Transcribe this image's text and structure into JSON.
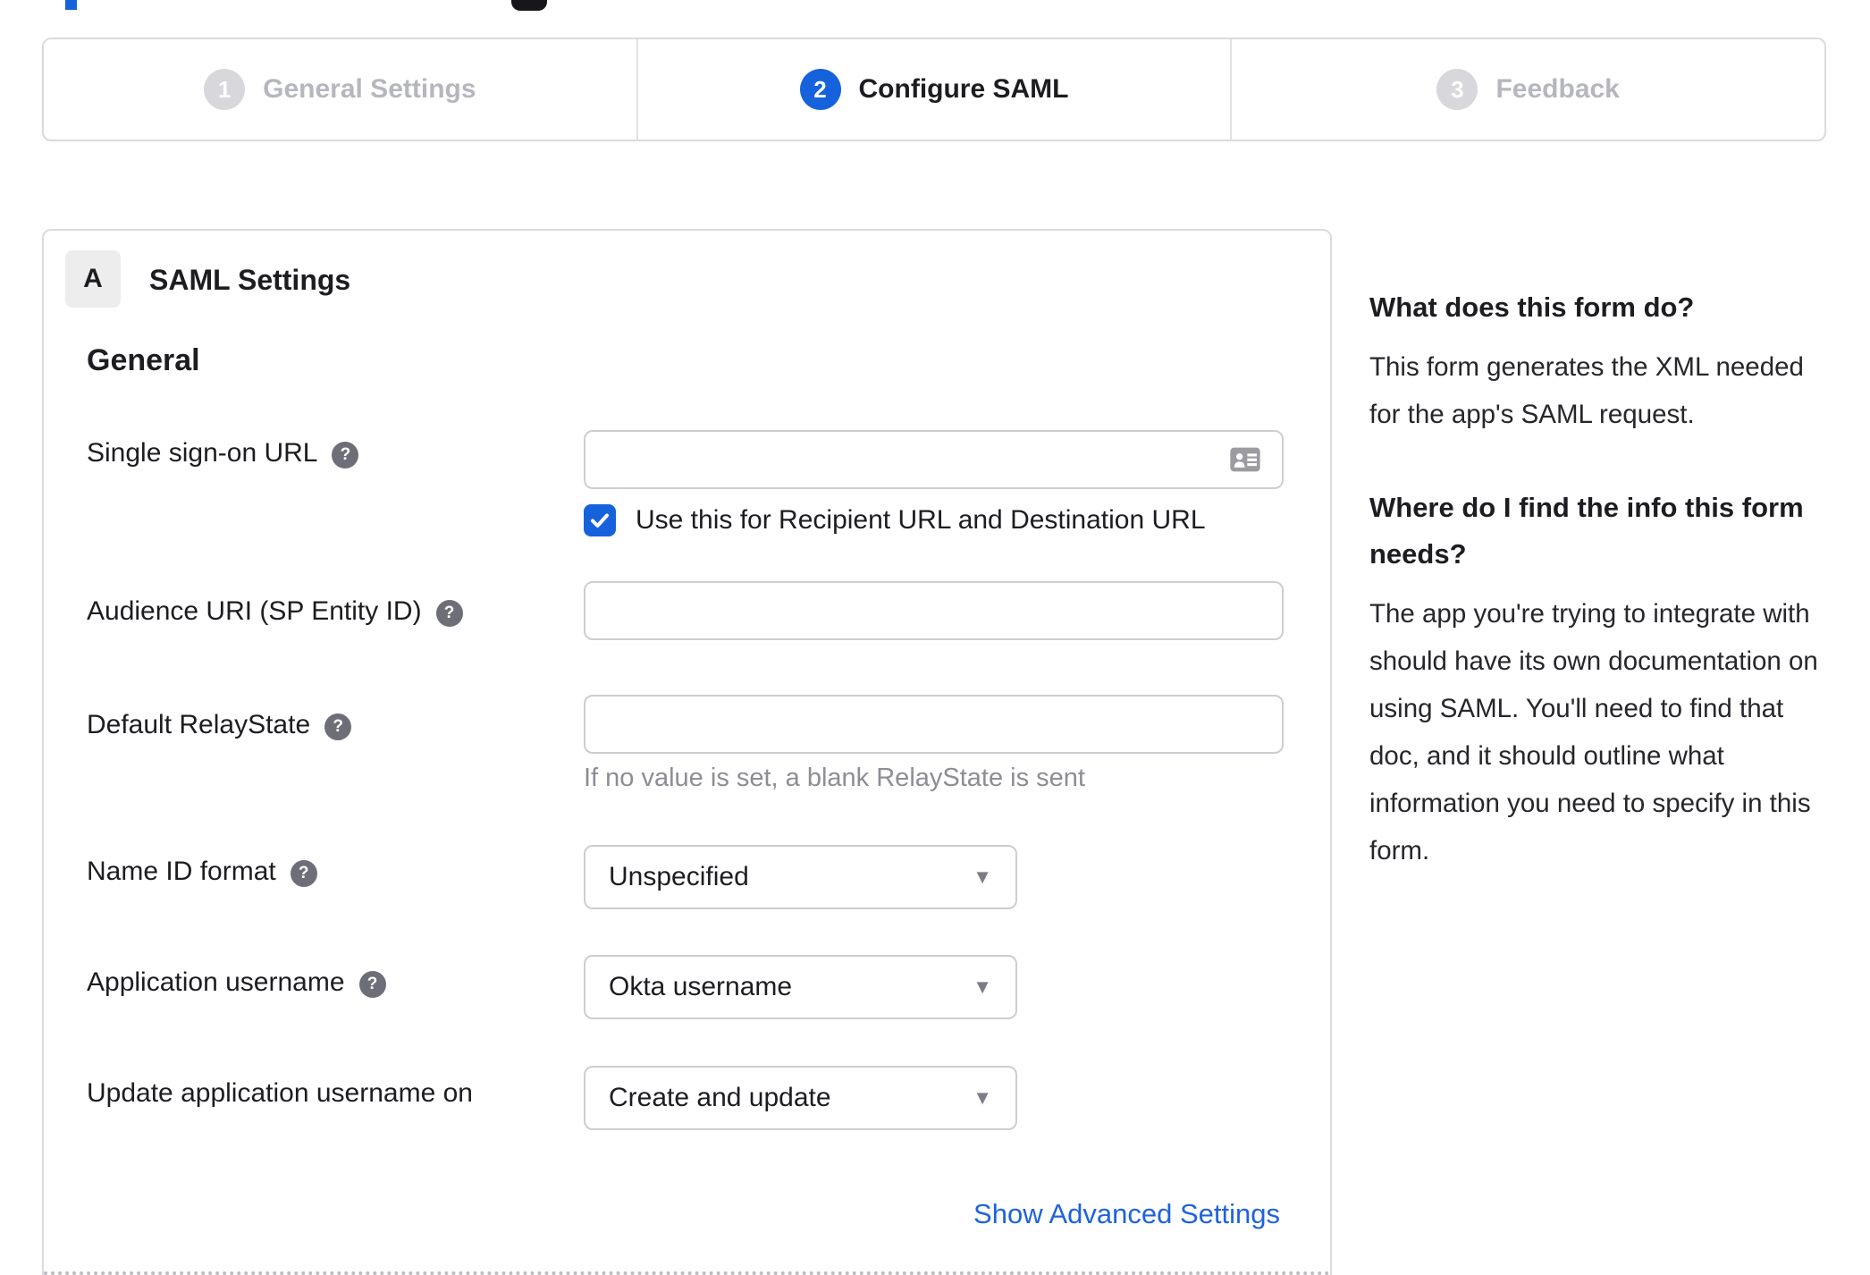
{
  "icons": {
    "help_glyph": "?",
    "caret_glyph": "▼"
  },
  "colors": {
    "accent_blue": "#1662dd",
    "inactive_gray": "#d7d7dc",
    "border_gray": "#dbdbdf",
    "muted_text": "#8d8d95"
  },
  "stepper": {
    "steps": [
      {
        "number": "1",
        "label": "General Settings",
        "state": "inactive"
      },
      {
        "number": "2",
        "label": "Configure SAML",
        "state": "active"
      },
      {
        "number": "3",
        "label": "Feedback",
        "state": "inactive"
      }
    ]
  },
  "panel": {
    "section_badge": "A",
    "section_title": "SAML Settings",
    "subsection_title": "General",
    "fields": [
      {
        "label": "Single sign-on URL",
        "type": "text",
        "value": "",
        "trailing_icon": "contact-card-icon",
        "checkbox": {
          "checked": true,
          "label": "Use this for Recipient URL and Destination URL"
        }
      },
      {
        "label": "Audience URI (SP Entity ID)",
        "type": "text",
        "value": ""
      },
      {
        "label": "Default RelayState",
        "type": "text",
        "value": "",
        "hint": "If no value is set, a blank RelayState is sent"
      },
      {
        "label": "Name ID format",
        "type": "select",
        "value": "Unspecified"
      },
      {
        "label": "Application username",
        "type": "select",
        "value": "Okta username"
      },
      {
        "label": "Update application username on",
        "type": "select",
        "value": "Create and update"
      }
    ],
    "advanced_link": "Show Advanced Settings"
  },
  "help_sidebar": {
    "blocks": [
      {
        "heading": "What does this form do?",
        "body": "This form generates the XML needed for the app's SAML request."
      },
      {
        "heading": "Where do I find the info this form needs?",
        "body": "The app you're trying to integrate with should have its own documentation on using SAML. You'll need to find that doc, and it should outline what information you need to specify in this form."
      }
    ]
  }
}
